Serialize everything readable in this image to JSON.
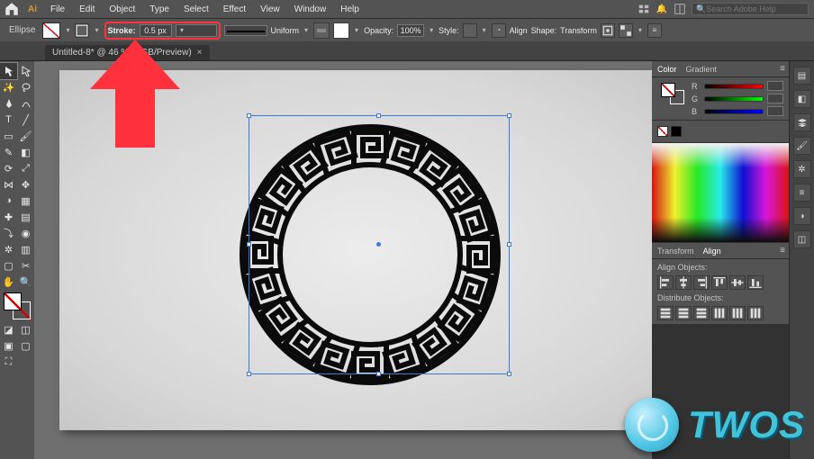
{
  "app": {
    "ai_logo": "Ai"
  },
  "menus": [
    "File",
    "Edit",
    "Object",
    "Type",
    "Select",
    "Effect",
    "View",
    "Window",
    "Help"
  ],
  "search_placeholder": "Search Adobe Help",
  "controlbar": {
    "shape_label": "Ellipse",
    "stroke_label": "Stroke:",
    "stroke_value": "0.5 px",
    "line_profile": "Uniform",
    "opacity_label": "Opacity:",
    "opacity_value": "100%",
    "style_label": "Style:",
    "align_label": "Align",
    "shape_label2": "Shape:",
    "transform_label": "Transform"
  },
  "doc_tab": {
    "title": "Untitled-8* @ 46 % (RGB/Preview)",
    "close": "×"
  },
  "toolbox": [
    [
      "selection",
      "direct-selection"
    ],
    [
      "magic-wand",
      "lasso"
    ],
    [
      "pen",
      "curvature"
    ],
    [
      "type",
      "line-segment"
    ],
    [
      "rectangle",
      "paintbrush"
    ],
    [
      "pencil",
      "eraser"
    ],
    [
      "rotate",
      "scale"
    ],
    [
      "width",
      "free-transform"
    ],
    [
      "shape-builder",
      "perspective"
    ],
    [
      "mesh",
      "gradient"
    ],
    [
      "eyedropper",
      "blend"
    ],
    [
      "symbol-sprayer",
      "column-graph"
    ],
    [
      "artboard",
      "slice"
    ],
    [
      "hand",
      "zoom"
    ]
  ],
  "right": {
    "color_tab1": "Color",
    "color_tab2": "Gradient",
    "sliders": {
      "r": "R",
      "g": "G",
      "b": "B",
      "r_val": "",
      "g_val": "",
      "b_val": ""
    },
    "swatch_black": "#000000",
    "transform_tab": "Transform",
    "align_tab": "Align",
    "align_section1": "Align Objects:",
    "align_section2": "Distribute Objects:"
  },
  "logo": {
    "text": "TWOS"
  }
}
